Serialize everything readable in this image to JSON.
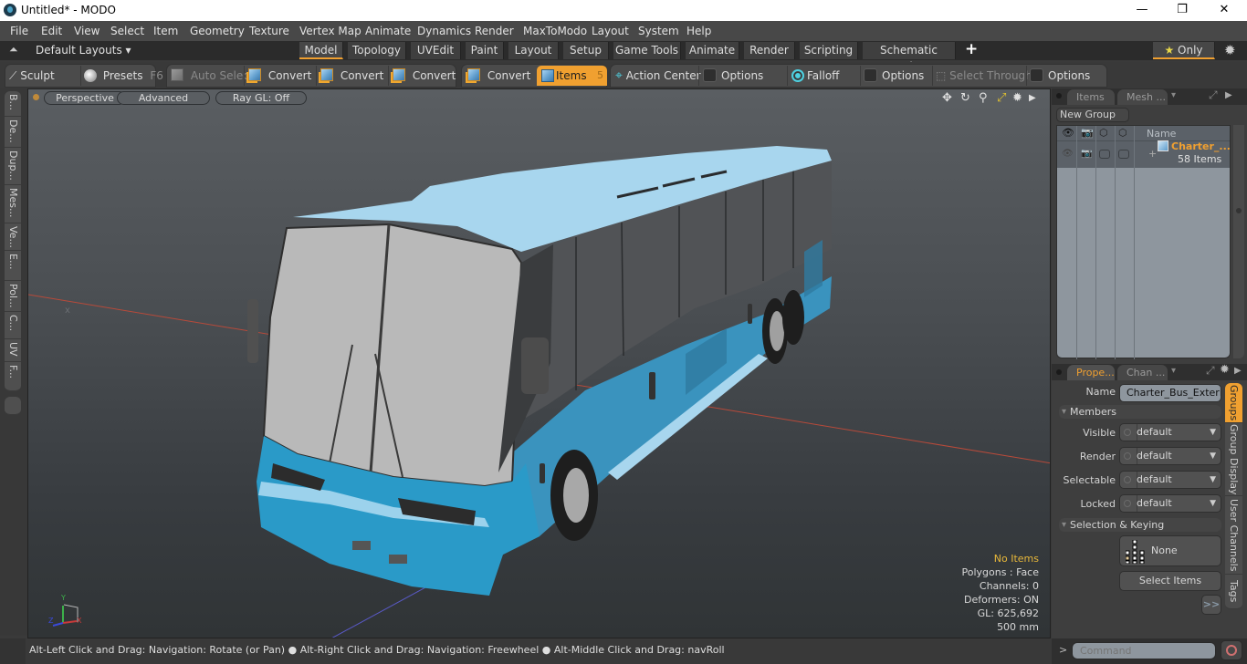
{
  "window": {
    "title": "Untitled* - MODO",
    "minimize": "—",
    "maximize": "❐",
    "close": "✕"
  },
  "menubar": {
    "items": [
      "File",
      "Edit",
      "View",
      "Select",
      "Item",
      "Geometry",
      "Texture",
      "Vertex Map",
      "Animate",
      "Dynamics",
      "Render",
      "MaxToModo",
      "Layout",
      "System",
      "Help"
    ]
  },
  "layoutbar": {
    "layouts_label": "Default Layouts ▾",
    "tabs": [
      "Model",
      "Topology",
      "UVEdit",
      "Paint",
      "Layout",
      "Setup",
      "Game Tools",
      "Animate",
      "Render",
      "Scripting",
      "Schematic Fusion"
    ],
    "active_tab": "Model",
    "add_tab": "+",
    "only_label": "Only",
    "star": "★",
    "gear": "✹"
  },
  "toolbar": {
    "sculpt": "Sculpt",
    "presets": "Presets",
    "presets_key": "F6",
    "auto_select": "Auto Select",
    "convert1": "Convert",
    "convert2": "Convert",
    "convert3": "Convert",
    "convert4": "Convert",
    "items": "Items",
    "items_key": "5",
    "action_center": "Action Center",
    "options1": "Options",
    "falloff": "Falloff",
    "options2": "Options",
    "select_through": "Select Through",
    "options3": "Options",
    "accent_color": "#f0a030"
  },
  "left_tabs": [
    "B...",
    "De...",
    "Dup...",
    "Mes...",
    "Ve...",
    "E...",
    "Pol...",
    "C...",
    "UV",
    "F..."
  ],
  "viewport": {
    "perspective": "Perspective",
    "advanced": "Advanced",
    "raygl": "Ray GL: Off",
    "info": {
      "selection": "No Items",
      "polygons": "Polygons : Face",
      "channels": "Channels: 0",
      "deformers": "Deformers: ON",
      "gl": "GL: 625,692",
      "scale": "500 mm"
    },
    "axis_y": "Y",
    "axis_x": "X",
    "axis_z": "Z",
    "bus_color": "#2a9ac8",
    "roof_color": "#a8d8f0"
  },
  "items_panel": {
    "tabs": [
      "Items",
      "Mesh ..."
    ],
    "new_group": "New Group",
    "column_name": "Name",
    "group_name": "Charter_...",
    "group_count": "58 Items",
    "expander": "+"
  },
  "properties_panel": {
    "tabs": [
      "Prope...",
      "Chan ..."
    ],
    "name_label": "Name",
    "name_value": "Charter_Bus_Exterio",
    "members_section": "Members",
    "visible_label": "Visible",
    "visible_value": "default",
    "render_label": "Render",
    "render_value": "default",
    "selectable_label": "Selectable",
    "selectable_value": "default",
    "locked_label": "Locked",
    "locked_value": "default",
    "keying_section": "Selection & Keying",
    "none_button": "None",
    "select_items_button": "Select Items",
    "more_button": ">>",
    "side_tabs": [
      "Groups",
      "Group Display",
      "User Channels",
      "Tags"
    ]
  },
  "statusbar": {
    "message": "Alt-Left Click and Drag: Navigation: Rotate (or Pan) ● Alt-Right Click and Drag: Navigation: Freewheel ● Alt-Middle Click and Drag: navRoll",
    "command_prompt": ">",
    "command_placeholder": "Command"
  }
}
